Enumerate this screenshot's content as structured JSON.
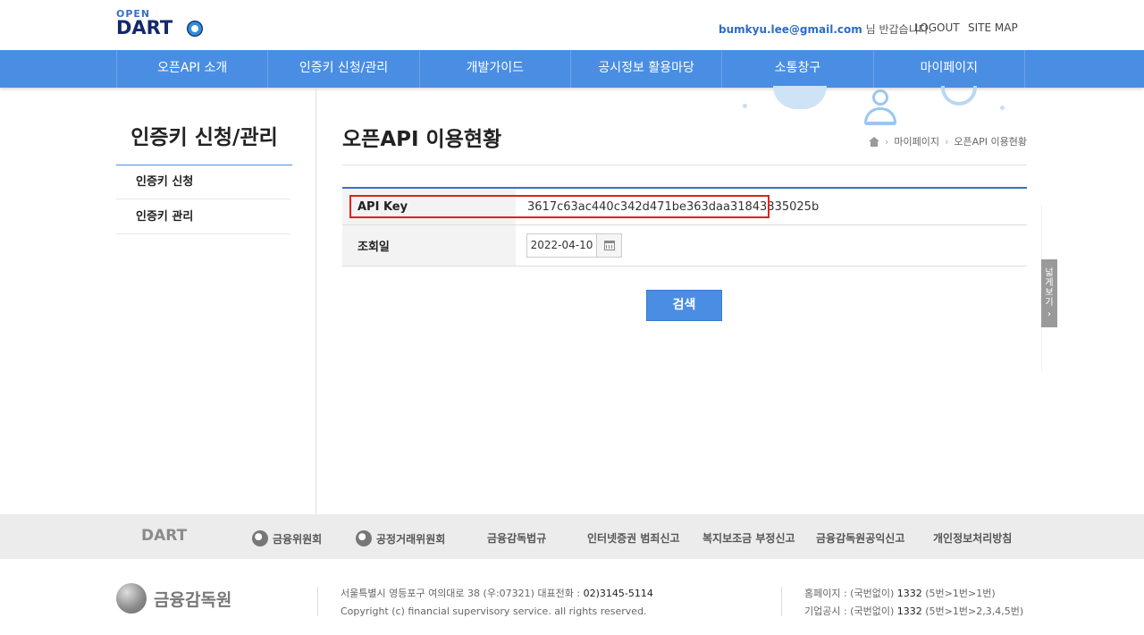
{
  "header": {
    "logo_open": "OPEN",
    "logo_dart": "DART",
    "user_email": "bumkyu.lee@gmail.com",
    "greeting": "님 반갑습니다.",
    "logout": "LOGOUT",
    "sitemap": "SITE MAP"
  },
  "gnb": {
    "items": [
      "오픈API 소개",
      "인증키 신청/관리",
      "개발가이드",
      "공시정보 활용마당",
      "소통창구",
      "마이페이지"
    ]
  },
  "sidebar": {
    "title": "인증키 신청/관리",
    "items": [
      {
        "label": "인증키 신청"
      },
      {
        "label": "인증키 관리"
      },
      {
        "label": "오픈API 이용현황"
      }
    ]
  },
  "main": {
    "title": "오픈API 이용현황",
    "breadcrumb": [
      "마이페이지",
      "오픈API 이용현황"
    ],
    "api_key_label": "API Key",
    "api_key_value": "3617c63ac440c342d471be363daa31843335025b",
    "date_label": "조회일",
    "date_value": "2022-04-10",
    "search_button": "검색",
    "side_tab": "넓게보기"
  },
  "footer": {
    "links": [
      "DART",
      "금융위원회",
      "공정거래위원회",
      "금융감독법규",
      "인터넷증권 범죄신고",
      "복지보조금 부정신고",
      "금융감독원공익신고",
      "개인정보처리방침"
    ],
    "org_name": "금융감독원",
    "address": "서울특별시 영등포구 여의대로 38 (우:07321) 대표전화 :",
    "phone": "02)3145-5114",
    "copyright": "Copyright (c) financial supervisory service. all rights reserved.",
    "homepage_label": "홈페이지 : (국번없이)",
    "homepage_num": "1332",
    "homepage_ext": "(5번>1번>1번)",
    "disclosure_label": "기업공시 : (국번없이)",
    "disclosure_num": "1332",
    "disclosure_ext": "(5번>1번>2,3,4,5번)"
  },
  "colors": {
    "accent": "#4a8ee3",
    "highlight": "#e02020"
  }
}
